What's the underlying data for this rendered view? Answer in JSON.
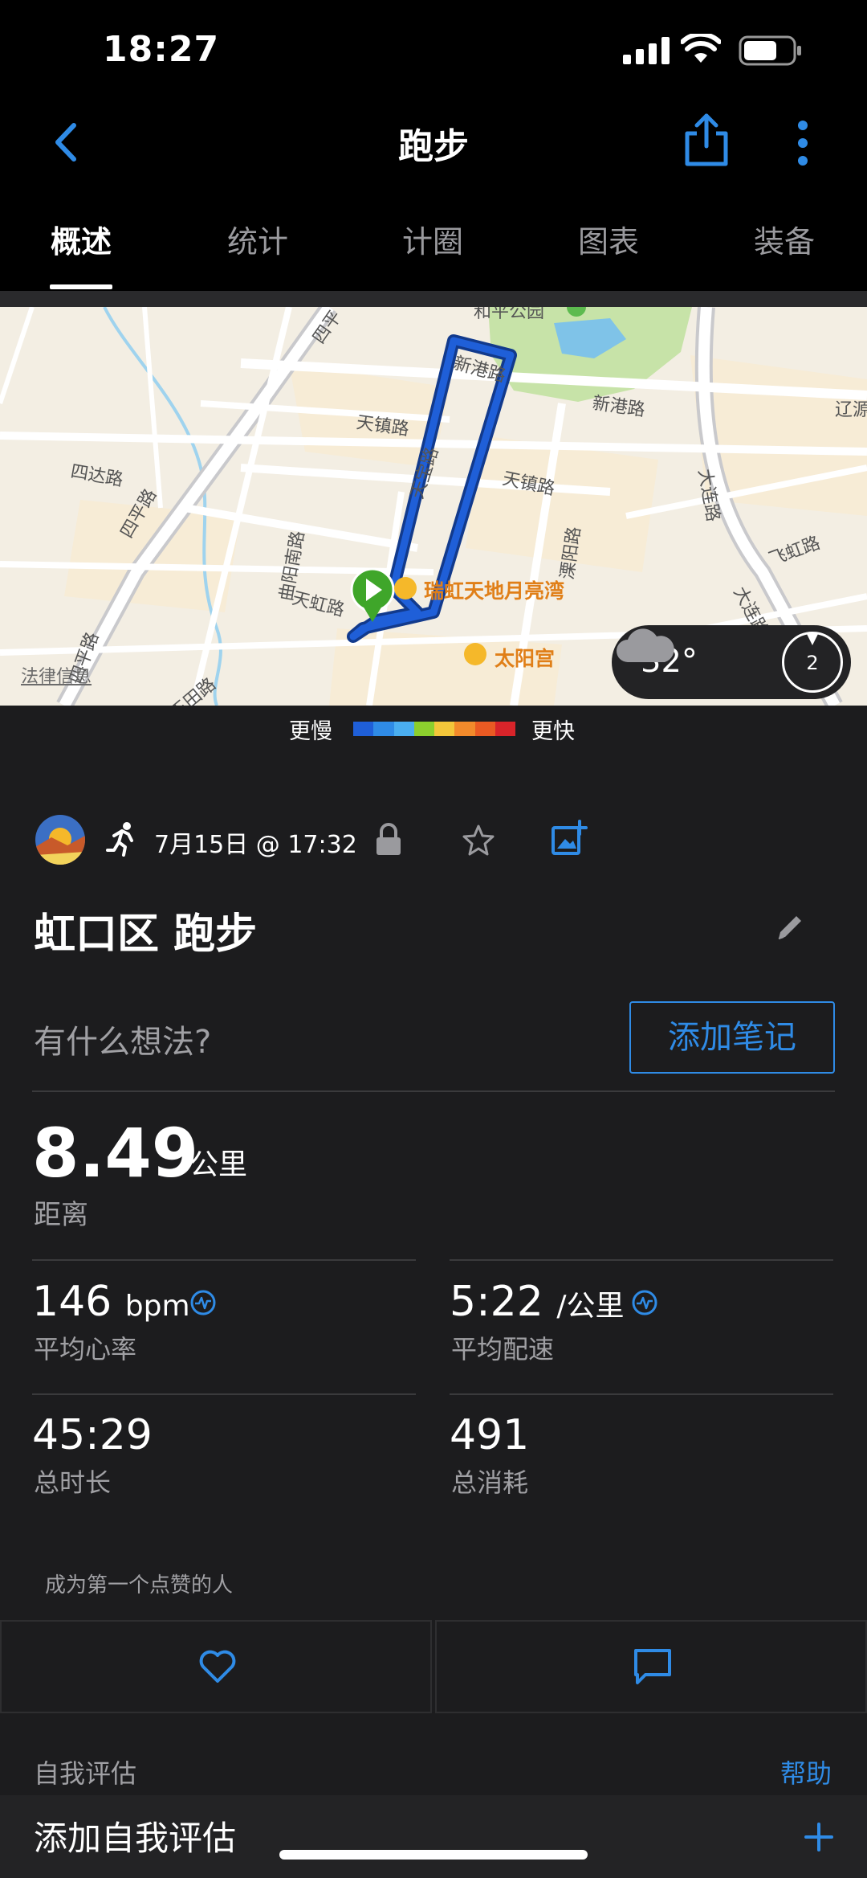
{
  "status_bar": {
    "time": "18:27"
  },
  "header": {
    "title": "跑步"
  },
  "tabs": [
    {
      "label": "概述",
      "active": true
    },
    {
      "label": "统计",
      "active": false
    },
    {
      "label": "计圈",
      "active": false
    },
    {
      "label": "图表",
      "active": false
    },
    {
      "label": "装备",
      "active": false
    }
  ],
  "map": {
    "labels": {
      "park": "和平公园",
      "xingang_road_1": "新港路",
      "xingang_road_2": "新港路",
      "liaoyuan": "辽源",
      "tianzhen_road_1": "天镇路",
      "tianzhen_road_2": "天镇路",
      "tianbao_road": "天宝路",
      "sida_road": "四达路",
      "siping_road_1": "四平路",
      "siping_road_2": "四平路",
      "siping_road_top": "四平",
      "quyang_road": "曲阳南路",
      "tianhong_road": "天虹路",
      "dalian_road_1": "大连路",
      "dalian_road_2": "大连路",
      "feihong_road": "飞虹路",
      "liyang_road": "溧阳路",
      "yuxi_road": "玉田路"
    },
    "pois": {
      "ruihong": "瑞虹天地月亮湾",
      "taiyang": "太阳宫"
    },
    "legal_link": "法律信息",
    "weather": {
      "temperature": "32°",
      "wind": "2"
    },
    "route_color": "#1f5fd8"
  },
  "legend": {
    "slow_label": "更慢",
    "fast_label": "更快",
    "colors": [
      "#1f5fd8",
      "#2f8be6",
      "#4aaef0",
      "#8ccf2e",
      "#f3c63a",
      "#f28a2b",
      "#ea5a23",
      "#d8242a"
    ]
  },
  "activity": {
    "date_time": "7月15日 @ 17:32",
    "title": "虹口区 跑步",
    "notes_placeholder": "有什么想法?",
    "add_note_label": "添加笔记",
    "distance": {
      "value": "8.49",
      "unit": "公里",
      "label": "距离"
    },
    "stats": {
      "heart_rate": {
        "value": "146",
        "unit": "bpm",
        "label": "平均心率"
      },
      "pace": {
        "value": "5:22",
        "unit": "/公里",
        "label": "平均配速"
      },
      "duration": {
        "value": "45:29",
        "label": "总时长"
      },
      "calories": {
        "value": "491",
        "label": "总消耗"
      }
    },
    "likes_text": "成为第一个点赞的人"
  },
  "self_evaluation": {
    "section_label": "自我评估",
    "help_label": "帮助",
    "add_label": "添加自我评估"
  },
  "accent_color": "#2f8be6"
}
